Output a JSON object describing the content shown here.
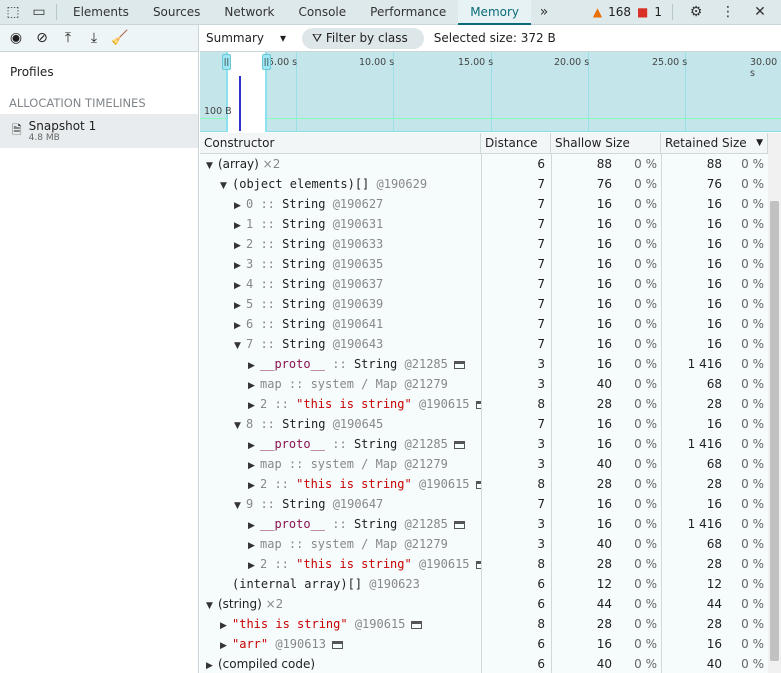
{
  "tabs": [
    "Elements",
    "Sources",
    "Network",
    "Console",
    "Performance",
    "Memory"
  ],
  "active_tab": "Memory",
  "warnings": "168",
  "errors": "1",
  "sidebar": {
    "profiles": "Profiles",
    "section": "ALLOCATION TIMELINES",
    "snapshot": {
      "title": "Snapshot 1",
      "size": "4.8 MB"
    }
  },
  "toolbar": {
    "view": "Summary",
    "filter_placeholder": "Filter by class",
    "selected_size": "Selected size: 372 B"
  },
  "timeline": {
    "ticks": [
      "5.00 s",
      "10.00 s",
      "15.00 s",
      "20.00 s",
      "25.00 s",
      "30.00 s"
    ],
    "scale_label": "100 B"
  },
  "columns": [
    "Constructor",
    "Distance",
    "Shallow Size",
    "Retained Size"
  ],
  "rows": [
    {
      "l": 0,
      "a": "down",
      "parts": [
        [
          "(array)",
          ""
        ],
        [
          "  ×2",
          "dim"
        ]
      ],
      "d": "6",
      "s": "88",
      "r": "88"
    },
    {
      "l": 1,
      "a": "down",
      "parts": [
        [
          "(object elements)[]",
          ""
        ],
        [
          " @190629",
          "dim"
        ]
      ],
      "d": "7",
      "s": "76",
      "r": "76"
    },
    {
      "l": 2,
      "a": "right",
      "parts": [
        [
          "0 :: ",
          "dim"
        ],
        [
          "String",
          ""
        ],
        [
          " @190627",
          "dim"
        ]
      ],
      "d": "7",
      "s": "16",
      "r": "16"
    },
    {
      "l": 2,
      "a": "right",
      "parts": [
        [
          "1 :: ",
          "dim"
        ],
        [
          "String",
          ""
        ],
        [
          " @190631",
          "dim"
        ]
      ],
      "d": "7",
      "s": "16",
      "r": "16"
    },
    {
      "l": 2,
      "a": "right",
      "parts": [
        [
          "2 :: ",
          "dim"
        ],
        [
          "String",
          ""
        ],
        [
          " @190633",
          "dim"
        ]
      ],
      "d": "7",
      "s": "16",
      "r": "16"
    },
    {
      "l": 2,
      "a": "right",
      "parts": [
        [
          "3 :: ",
          "dim"
        ],
        [
          "String",
          ""
        ],
        [
          " @190635",
          "dim"
        ]
      ],
      "d": "7",
      "s": "16",
      "r": "16"
    },
    {
      "l": 2,
      "a": "right",
      "parts": [
        [
          "4 :: ",
          "dim"
        ],
        [
          "String",
          ""
        ],
        [
          " @190637",
          "dim"
        ]
      ],
      "d": "7",
      "s": "16",
      "r": "16"
    },
    {
      "l": 2,
      "a": "right",
      "parts": [
        [
          "5 :: ",
          "dim"
        ],
        [
          "String",
          ""
        ],
        [
          " @190639",
          "dim"
        ]
      ],
      "d": "7",
      "s": "16",
      "r": "16"
    },
    {
      "l": 2,
      "a": "right",
      "parts": [
        [
          "6 :: ",
          "dim"
        ],
        [
          "String",
          ""
        ],
        [
          " @190641",
          "dim"
        ]
      ],
      "d": "7",
      "s": "16",
      "r": "16"
    },
    {
      "l": 2,
      "a": "down",
      "parts": [
        [
          "7 :: ",
          "dim"
        ],
        [
          "String",
          ""
        ],
        [
          " @190643",
          "dim"
        ]
      ],
      "d": "7",
      "s": "16",
      "r": "16"
    },
    {
      "l": 3,
      "a": "right",
      "parts": [
        [
          "__proto__",
          "prop"
        ],
        [
          " :: ",
          "dim"
        ],
        [
          "String",
          ""
        ],
        [
          " @21285",
          "dim"
        ]
      ],
      "w": true,
      "d": "3",
      "s": "16",
      "r": "1 416"
    },
    {
      "l": 3,
      "a": "right",
      "parts": [
        [
          "map :: system / Map @21279",
          "dim"
        ]
      ],
      "d": "3",
      "s": "40",
      "r": "68"
    },
    {
      "l": 3,
      "a": "right",
      "parts": [
        [
          "2 :: ",
          "dim"
        ],
        [
          "\"this is string\"",
          "str"
        ],
        [
          " @190615",
          "dim"
        ]
      ],
      "w": true,
      "d": "8",
      "s": "28",
      "r": "28"
    },
    {
      "l": 2,
      "a": "down",
      "parts": [
        [
          "8 :: ",
          "dim"
        ],
        [
          "String",
          ""
        ],
        [
          " @190645",
          "dim"
        ]
      ],
      "d": "7",
      "s": "16",
      "r": "16"
    },
    {
      "l": 3,
      "a": "right",
      "parts": [
        [
          "__proto__",
          "prop"
        ],
        [
          " :: ",
          "dim"
        ],
        [
          "String",
          ""
        ],
        [
          " @21285",
          "dim"
        ]
      ],
      "w": true,
      "d": "3",
      "s": "16",
      "r": "1 416"
    },
    {
      "l": 3,
      "a": "right",
      "parts": [
        [
          "map :: system / Map @21279",
          "dim"
        ]
      ],
      "d": "3",
      "s": "40",
      "r": "68"
    },
    {
      "l": 3,
      "a": "right",
      "parts": [
        [
          "2 :: ",
          "dim"
        ],
        [
          "\"this is string\"",
          "str"
        ],
        [
          " @190615",
          "dim"
        ]
      ],
      "w": true,
      "d": "8",
      "s": "28",
      "r": "28"
    },
    {
      "l": 2,
      "a": "down",
      "parts": [
        [
          "9 :: ",
          "dim"
        ],
        [
          "String",
          ""
        ],
        [
          " @190647",
          "dim"
        ]
      ],
      "d": "7",
      "s": "16",
      "r": "16"
    },
    {
      "l": 3,
      "a": "right",
      "parts": [
        [
          "__proto__",
          "prop"
        ],
        [
          " :: ",
          "dim"
        ],
        [
          "String",
          ""
        ],
        [
          " @21285",
          "dim"
        ]
      ],
      "w": true,
      "d": "3",
      "s": "16",
      "r": "1 416"
    },
    {
      "l": 3,
      "a": "right",
      "parts": [
        [
          "map :: system / Map @21279",
          "dim"
        ]
      ],
      "d": "3",
      "s": "40",
      "r": "68"
    },
    {
      "l": 3,
      "a": "right",
      "parts": [
        [
          "2 :: ",
          "dim"
        ],
        [
          "\"this is string\"",
          "str"
        ],
        [
          " @190615",
          "dim"
        ]
      ],
      "w": true,
      "d": "8",
      "s": "28",
      "r": "28"
    },
    {
      "l": 1,
      "a": "none",
      "parts": [
        [
          "(internal array)[]",
          ""
        ],
        [
          " @190623",
          "dim"
        ]
      ],
      "d": "6",
      "s": "12",
      "r": "12"
    },
    {
      "l": 0,
      "a": "down",
      "parts": [
        [
          "(string)",
          ""
        ],
        [
          "  ×2",
          "dim"
        ]
      ],
      "d": "6",
      "s": "44",
      "r": "44"
    },
    {
      "l": 1,
      "a": "right",
      "parts": [
        [
          "\"this is string\"",
          "str"
        ],
        [
          " @190615",
          "dim"
        ]
      ],
      "w": true,
      "d": "8",
      "s": "28",
      "r": "28"
    },
    {
      "l": 1,
      "a": "right",
      "parts": [
        [
          "\"arr\"",
          "str"
        ],
        [
          " @190613",
          "dim"
        ]
      ],
      "w": true,
      "d": "6",
      "s": "16",
      "r": "16"
    },
    {
      "l": 0,
      "a": "right",
      "parts": [
        [
          "(compiled code)",
          ""
        ]
      ],
      "d": "6",
      "s": "40",
      "r": "40"
    }
  ],
  "pct": "0 %"
}
